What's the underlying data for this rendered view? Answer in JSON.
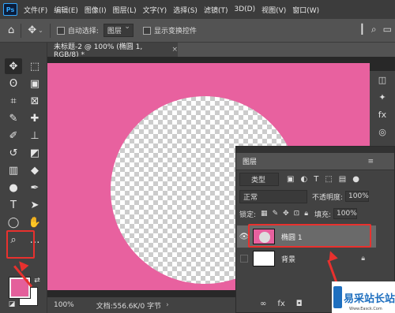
{
  "app": {
    "logo_text": "Ps"
  },
  "menu": [
    "文件(F)",
    "编辑(E)",
    "图像(I)",
    "图层(L)",
    "文字(Y)",
    "选择(S)",
    "滤镜(T)",
    "3D(D)",
    "视图(V)",
    "窗口(W)"
  ],
  "options": {
    "auto_select_label": "自动选择:",
    "auto_select_value": "图层",
    "show_transform_label": "显示变换控件"
  },
  "document": {
    "tab_title": "未标题-2 @ 100% (椭圆 1, RGB/8) *",
    "close_glyph": "×"
  },
  "status": {
    "zoom": "100%",
    "doc_size": "文档:556.6K/0 字节"
  },
  "colors": {
    "foreground": "#e45f9b",
    "background": "#ffffff",
    "canvas": "#e8619f",
    "annotation": "#e8312e"
  },
  "layers_panel": {
    "tab": "图层",
    "filter_value": "类型",
    "blend_mode": "正常",
    "opacity_label": "不透明度:",
    "opacity_value": "100%",
    "lock_label": "锁定:",
    "fill_label": "填充:",
    "fill_value": "100%",
    "layers": [
      {
        "name": "椭圆 1",
        "visible": true,
        "selected": true
      },
      {
        "name": "背景",
        "visible": false,
        "selected": false,
        "locked": true
      }
    ],
    "footer_fx": "fx"
  },
  "watermark": {
    "text": "易采站长站",
    "sub": "Www.Easck.Com"
  }
}
